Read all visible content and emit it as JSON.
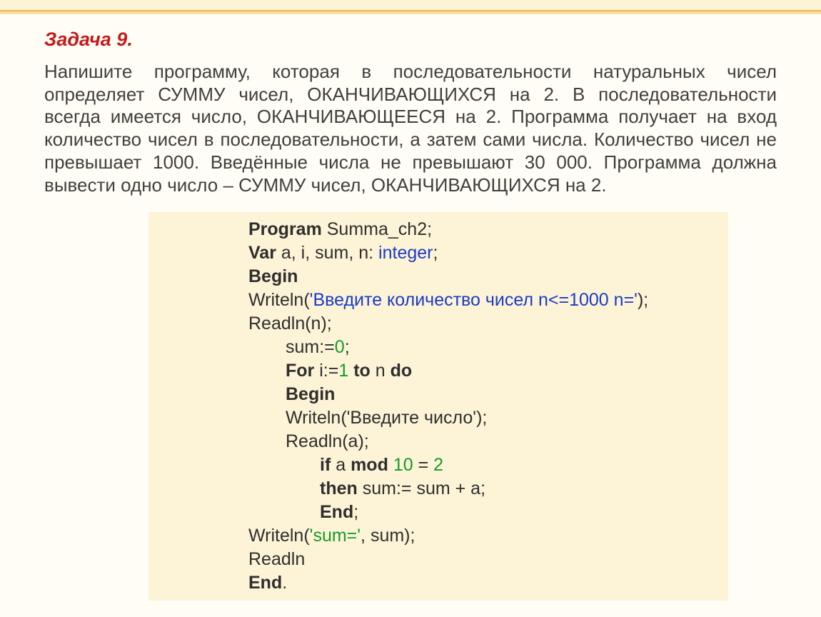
{
  "task": {
    "title": "Задача 9.",
    "description": "Напишите программу, которая в последовательности натуральных чисел определяет СУММУ чисел, ОКАНЧИВАЮЩИХСЯ на 2. В последовательности всегда имеется число, ОКАНЧИВАЮЩЕЕСЯ на 2. Программа получает на вход количество чисел в последовательности, а затем сами числа. Количество чисел не превышает 1000. Введённые числа не превышают 30 000. Программа должна вывести одно число – СУММУ чисел, ОКАНЧИВАЮЩИХСЯ на 2."
  },
  "code": {
    "l1": {
      "kw": "Program",
      "rest": " Summa_ch2;"
    },
    "l2": {
      "kw": "Var",
      "mid": " a, i, sum, n: ",
      "type": "integer",
      "end": ";"
    },
    "l3": {
      "kw": "Begin"
    },
    "l4": {
      "pre": "Writeln(",
      "str": "'Введите количество чисел n<=1000 n='",
      "post": ");"
    },
    "l5": {
      "text": "Readln(n);"
    },
    "l6": {
      "pre": "sum:=",
      "num": "0",
      "post": ";"
    },
    "l7": {
      "kw1": "For",
      "mid1": " i:=",
      "num": "1",
      "mid2": " ",
      "kw2": "to",
      "mid3": " n ",
      "kw3": "do"
    },
    "l8": {
      "kw": "Begin"
    },
    "l9": {
      "text": "Writeln('Введите число');"
    },
    "l10": {
      "text": "Readln(a);"
    },
    "l11": {
      "kw1": "if",
      "mid1": " a ",
      "kw2": "mod",
      "mid2": " ",
      "num": "10",
      "mid3": " = ",
      "num2": "2"
    },
    "l12": {
      "kw": "then",
      "rest": " sum:= sum + a;"
    },
    "l13": {
      "kw": "End",
      "rest": ";"
    },
    "l14": {
      "pre": "Writeln(",
      "str": "'sum='",
      "post": ", sum);"
    },
    "l15": {
      "text": "Readln"
    },
    "l16": {
      "kw": "End",
      "rest": "."
    }
  }
}
